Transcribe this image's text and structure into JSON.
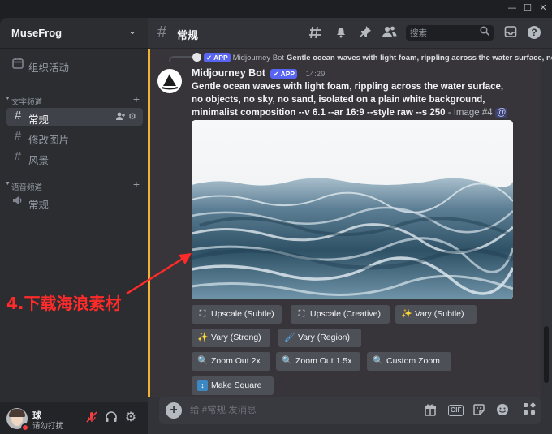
{
  "window": {
    "controls": [
      "—",
      "☐",
      "✕"
    ]
  },
  "server": {
    "name": "MuseFrog"
  },
  "sidebar": {
    "events_label": "组织活动",
    "text_category": "文字频道",
    "voice_category": "语音频道",
    "text_channels": [
      {
        "name": "常规",
        "active": true
      },
      {
        "name": "修改图片",
        "active": false
      },
      {
        "name": "风景",
        "active": false
      }
    ],
    "voice_channels": [
      {
        "name": "常规"
      }
    ]
  },
  "user": {
    "name": "球",
    "status": "请勿打扰"
  },
  "header": {
    "channel": "常规",
    "search_placeholder": "搜索"
  },
  "reply": {
    "app_tag": "APP",
    "author": "Midjourney Bot",
    "text": "Gentle ocean waves with light foam, rippling across the water surface, no"
  },
  "message": {
    "author": "Midjourney Bot",
    "app_tag": "APP",
    "time": "14:29",
    "prompt": "Gentle ocean waves with light foam, rippling across the water surface, no objects, no sky, no sand, isolated on a plain white background, minimalist composition --v 6.1 --ar 16:9 --style raw --s 250",
    "suffix": " - Image #4 ",
    "mention": "@球"
  },
  "buttons": {
    "upscale_subtle": "Upscale (Subtle)",
    "upscale_creative": "Upscale (Creative)",
    "vary_subtle": "Vary (Subtle)",
    "vary_strong": "Vary (Strong)",
    "vary_region": "Vary (Region)",
    "zoom_out_2x": "Zoom Out 2x",
    "zoom_out_15x": "Zoom Out 1.5x",
    "custom_zoom": "Custom Zoom",
    "make_square": "Make Square"
  },
  "composer": {
    "placeholder": "给 #常规 发消息",
    "gif": "GIF"
  },
  "annotation": {
    "text": "4.下载海浪素材",
    "color": "#ff2a2a"
  },
  "colors": {
    "accent": "#5865f2",
    "highlight": "#f0b232",
    "dnd": "#f23f43"
  }
}
